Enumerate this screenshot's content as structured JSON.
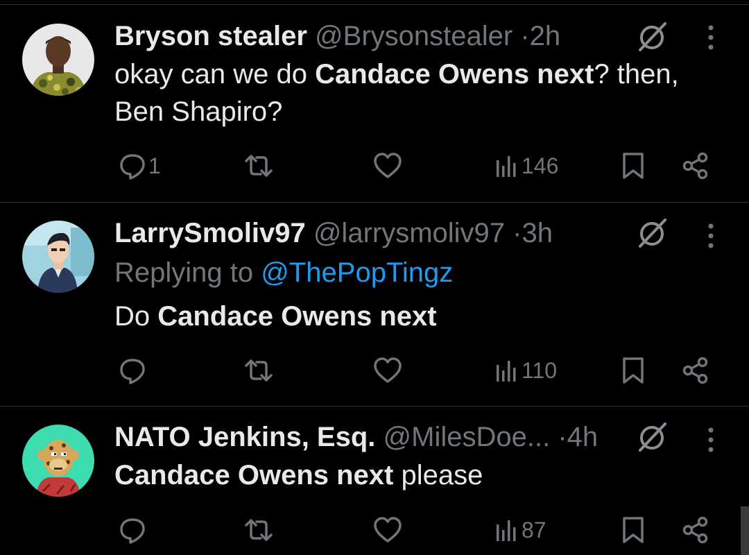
{
  "tweets": [
    {
      "name": "Bryson stealer",
      "handle": "@Brysonstealer",
      "dot": "·",
      "time": "2h",
      "reply_prefix": "",
      "reply_mention": "",
      "text_a": "okay can we do ",
      "text_bold": "Candace Owens next",
      "text_b": "? then,",
      "text_line2": "Ben Shapiro?",
      "replies": "1",
      "views": "146",
      "avatar": "man-portrait-camo-shirt"
    },
    {
      "name": "LarrySmoliv97",
      "handle": "@larrysmoliv97",
      "dot": "·",
      "time": "3h",
      "reply_prefix": "Replying to ",
      "reply_mention": "@ThePopTingz",
      "text_a": "Do ",
      "text_bold": "Candace Owens next",
      "text_b": "",
      "text_line2": "",
      "replies": "",
      "views": "110",
      "avatar": "cartoon-man-suit"
    },
    {
      "name": "NATO Jenkins, Esq.",
      "handle": "@MilesDoe...",
      "dot": "·",
      "time": "4h",
      "reply_prefix": "",
      "reply_mention": "",
      "text_a": "",
      "text_bold": "Candace Owens next",
      "text_b": " please",
      "text_line2": "",
      "replies": "",
      "views": "87",
      "avatar": "cartoon-ape-leopard"
    }
  ],
  "colors": {
    "background": "#000000",
    "text": "#e7e9ea",
    "secondary": "#71767b",
    "accent": "#1d9bf0",
    "divider": "#2f3336"
  },
  "icons": [
    "reply-icon",
    "retweet-icon",
    "like-icon",
    "views-icon",
    "bookmark-icon",
    "share-icon",
    "grok-icon",
    "more-icon"
  ]
}
